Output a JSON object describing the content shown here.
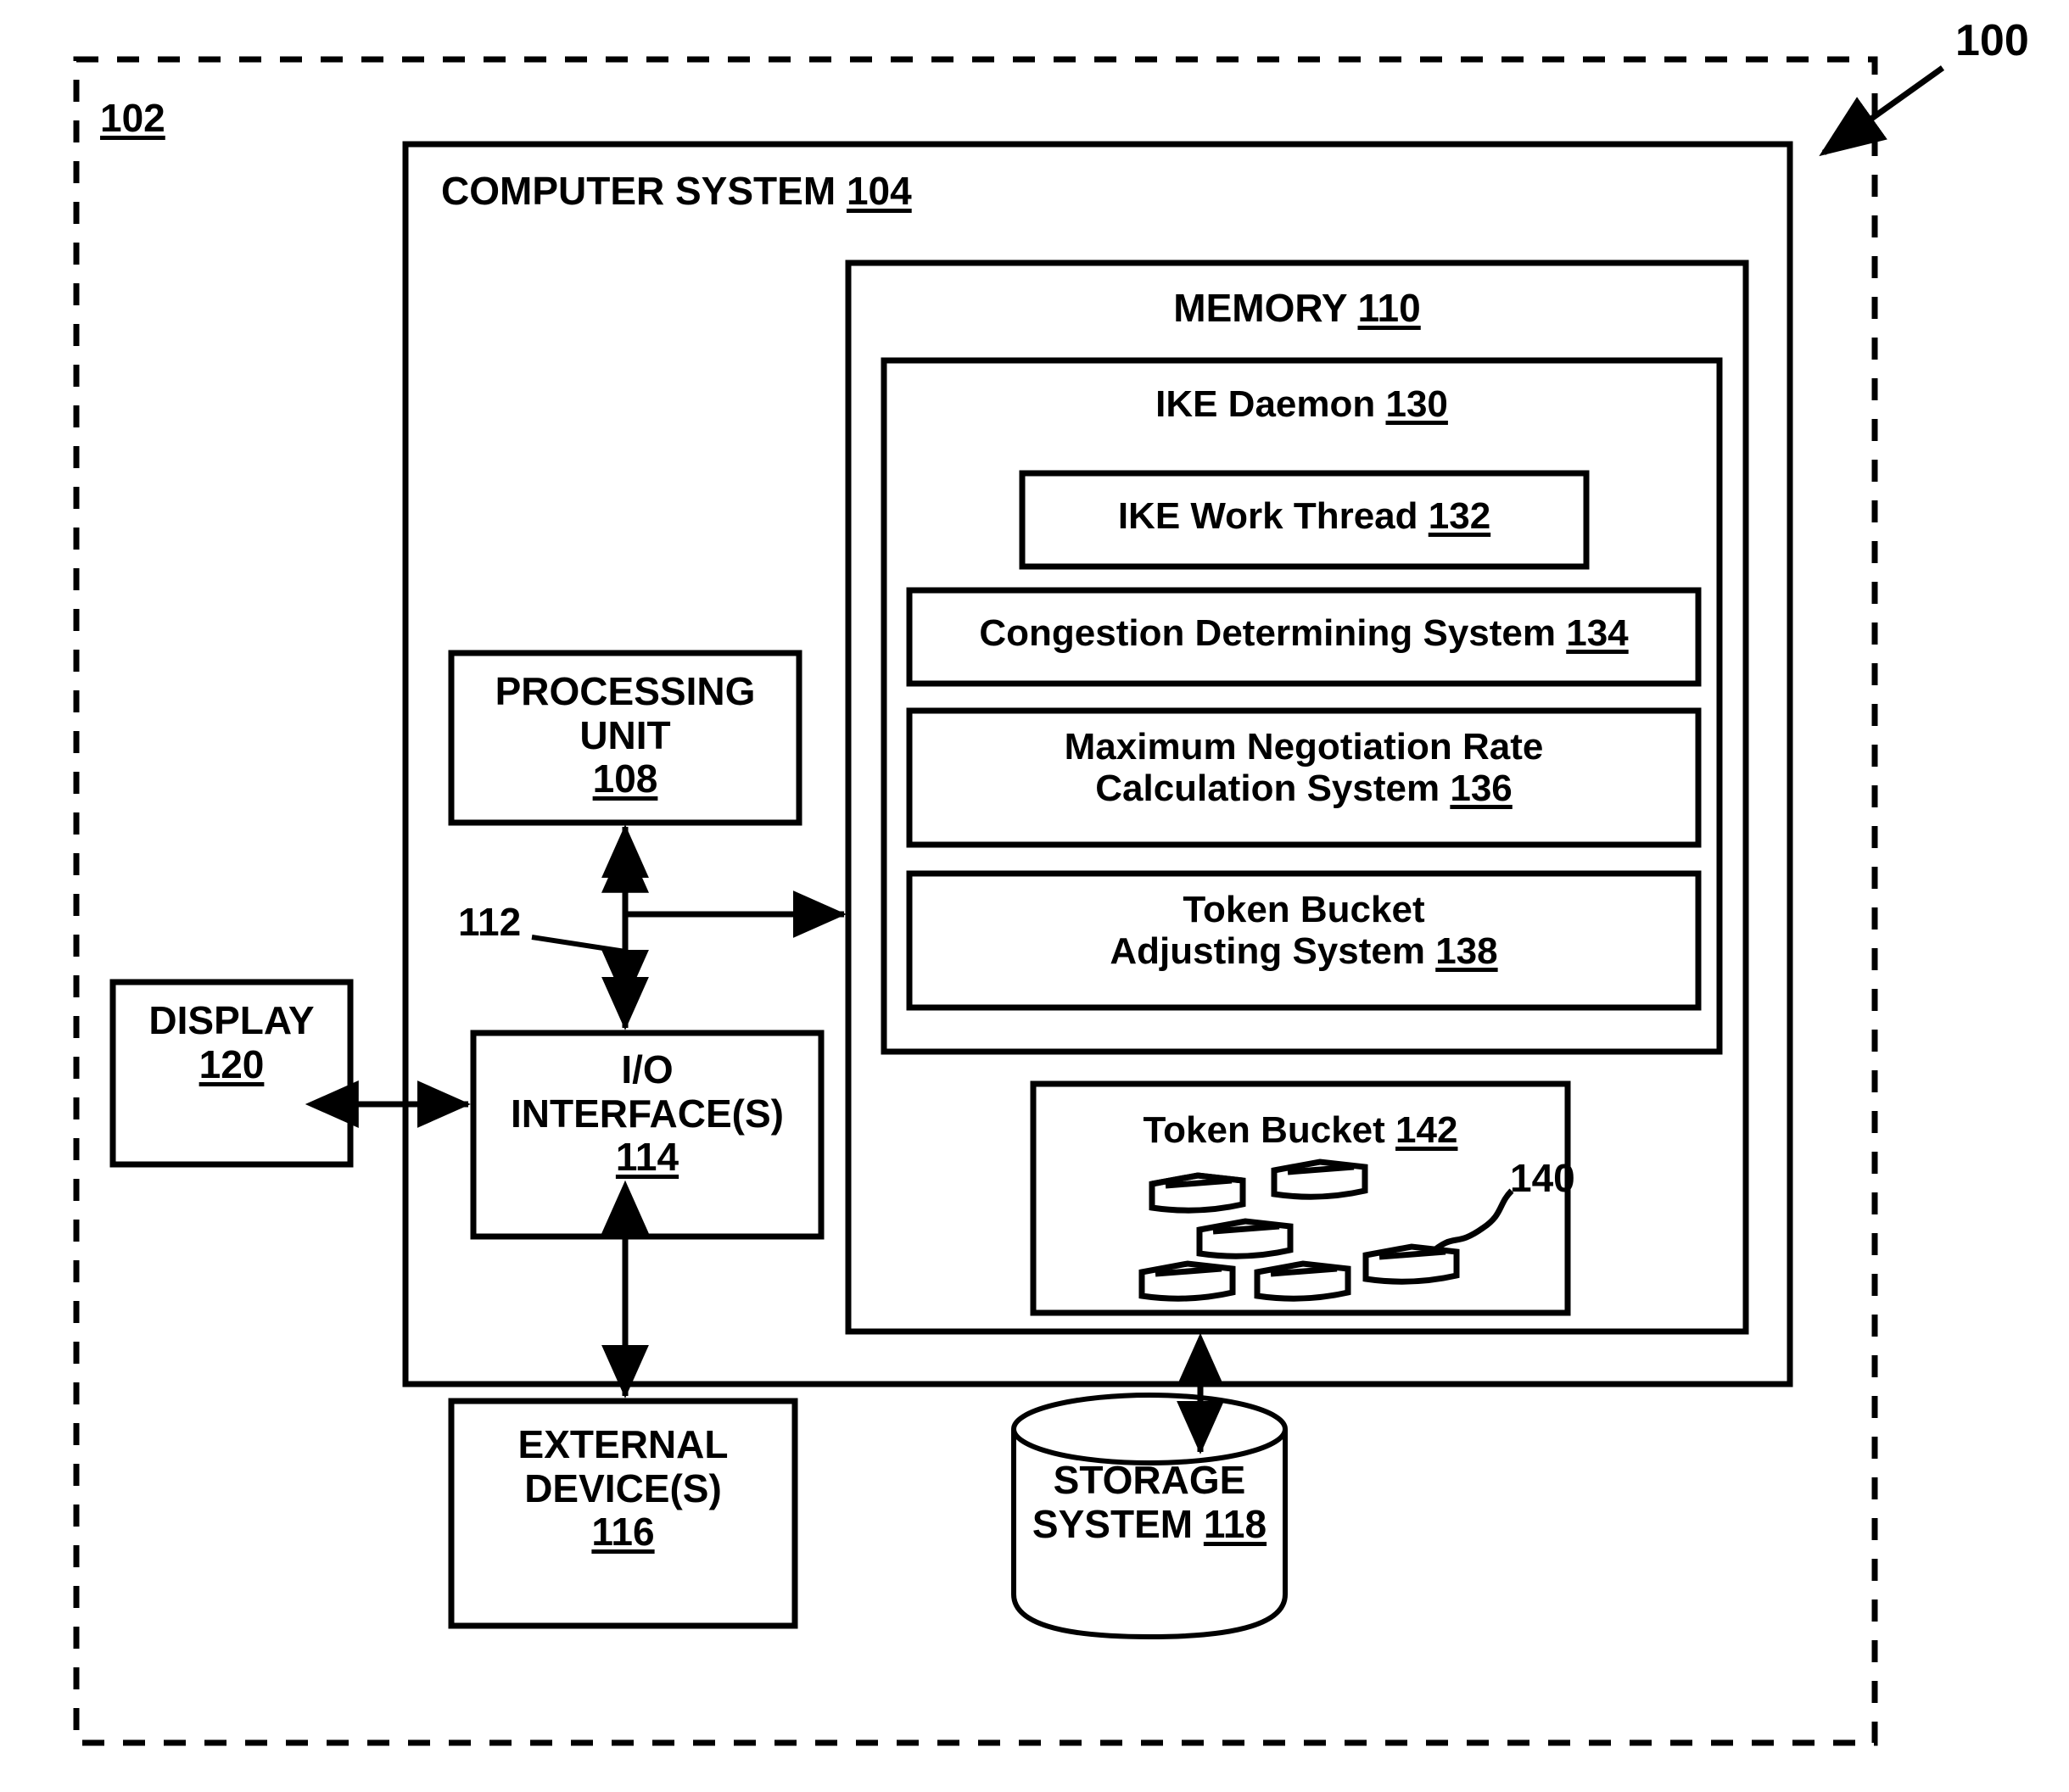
{
  "figure": {
    "outer_ref": "102",
    "figure_ref": "100"
  },
  "computer_system": {
    "title": "COMPUTER SYSTEM ",
    "ref": "104"
  },
  "memory": {
    "title": "MEMORY ",
    "ref": "110"
  },
  "ike_daemon": {
    "title": "IKE Daemon ",
    "ref": "130",
    "modules": [
      {
        "label": "IKE Work Thread ",
        "ref": "132"
      },
      {
        "label": "Congestion Determining System ",
        "ref": "134"
      },
      {
        "label": "Maximum Negotiation Rate\nCalculation System ",
        "ref": "136"
      },
      {
        "label": "Token Bucket\nAdjusting System ",
        "ref": "138"
      }
    ]
  },
  "token_bucket": {
    "title": "Token Bucket ",
    "ref": "142",
    "token_ref": "140",
    "token_count": 6
  },
  "processing_unit": {
    "label": "PROCESSING\nUNIT\n",
    "ref": "108"
  },
  "io_interface": {
    "label": "I/O\nINTERFACE(S)\n",
    "ref": "114"
  },
  "display": {
    "label": "DISPLAY\n",
    "ref": "120"
  },
  "external_devices": {
    "label": "EXTERNAL\nDEVICE(S)\n",
    "ref": "116"
  },
  "storage_system": {
    "label": "STORAGE\nSYSTEM ",
    "ref": "118"
  },
  "bus": {
    "ref": "112"
  },
  "colors": {
    "line": "#000000",
    "background": "#ffffff"
  }
}
